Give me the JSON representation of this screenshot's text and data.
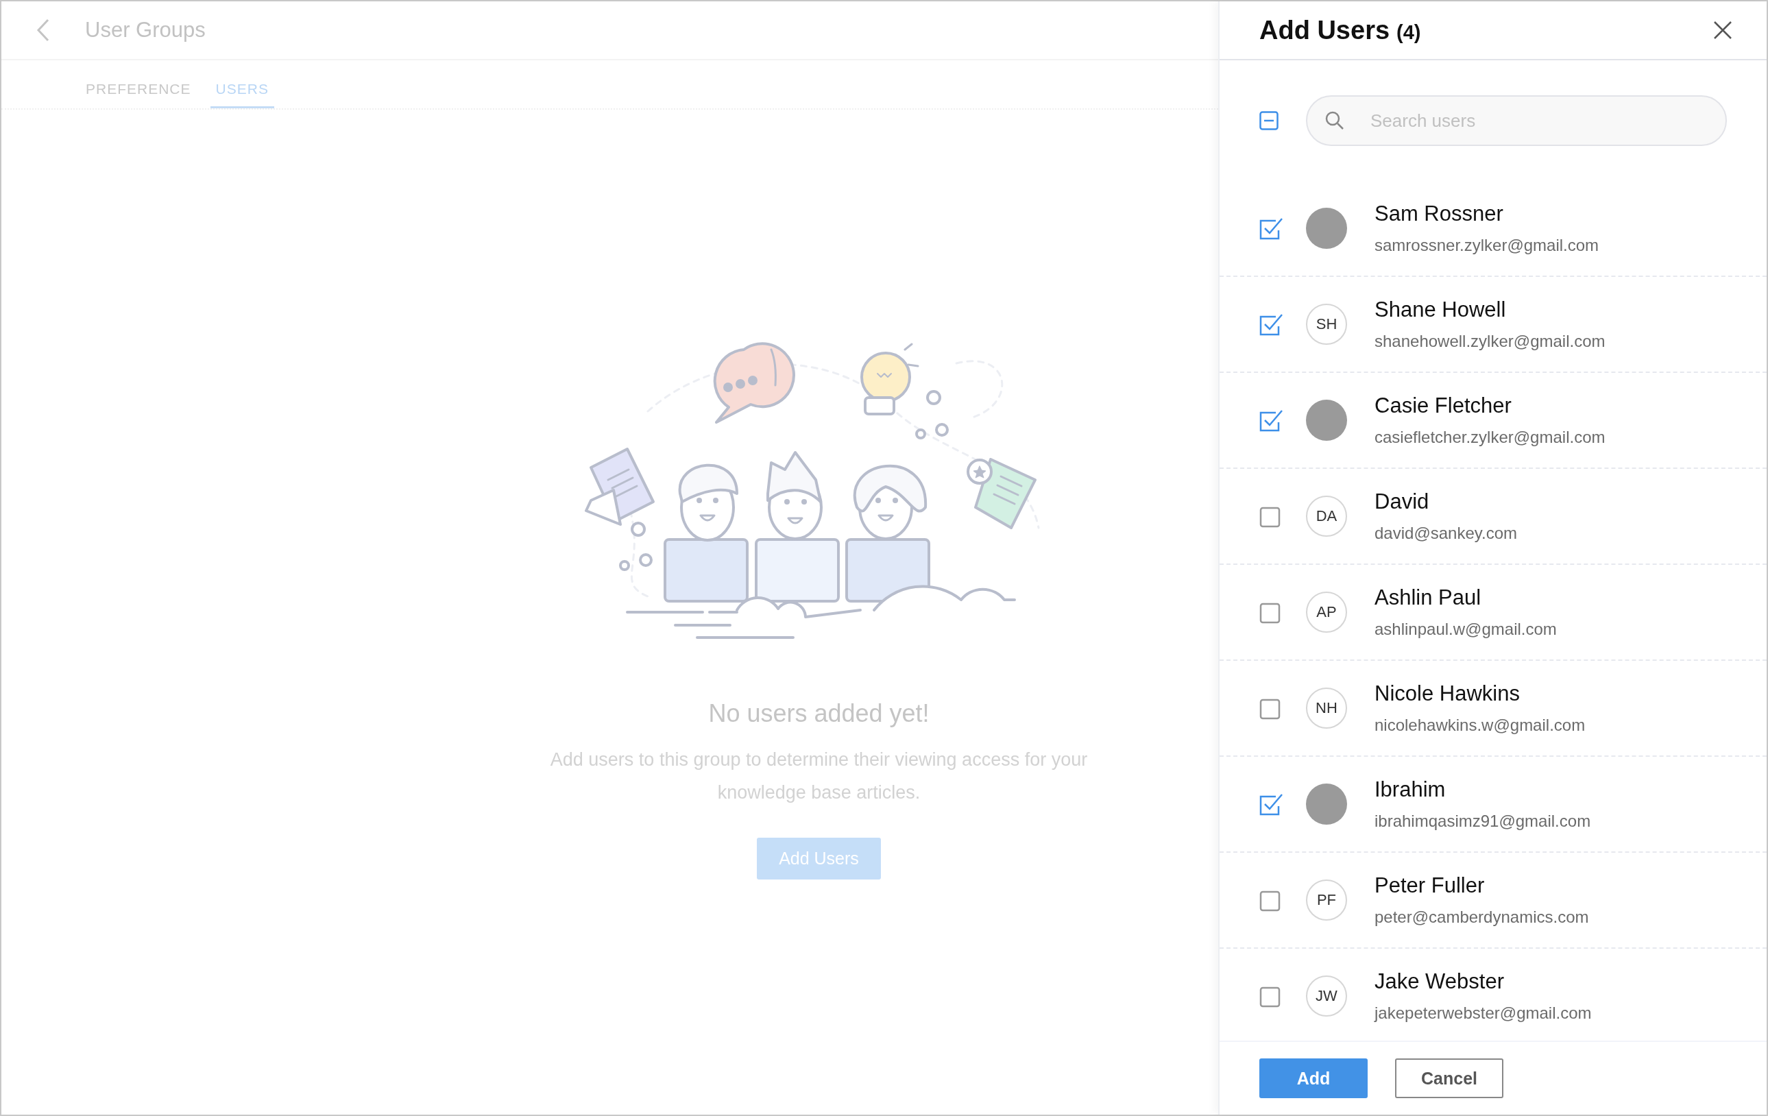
{
  "page": {
    "title": "User Groups",
    "tabs": [
      {
        "label": "PREFERENCE",
        "selected": false
      },
      {
        "label": "USERS",
        "selected": true
      }
    ],
    "empty_state": {
      "heading": "No users added yet!",
      "message": "Add users to this group to determine their viewing access for your knowledge base articles.",
      "button": "Add Users"
    }
  },
  "panel": {
    "title": "Add Users",
    "count": "(4)",
    "select_all": {
      "indeterminate": true
    },
    "search": {
      "placeholder": "Search users"
    },
    "users": [
      {
        "name": "Sam Rossner",
        "email": "samrossner.zylker@gmail.com",
        "checked": true,
        "kind": "photo"
      },
      {
        "name": "Shane Howell",
        "email": "shanehowell.zylker@gmail.com",
        "checked": true,
        "kind": "initials",
        "initials": "SH"
      },
      {
        "name": "Casie Fletcher",
        "email": "casiefletcher.zylker@gmail.com",
        "checked": true,
        "kind": "photo"
      },
      {
        "name": "David",
        "email": "david@sankey.com",
        "checked": false,
        "kind": "initials",
        "initials": "DA"
      },
      {
        "name": "Ashlin Paul",
        "email": "ashlinpaul.w@gmail.com",
        "checked": false,
        "kind": "initials",
        "initials": "AP"
      },
      {
        "name": "Nicole Hawkins",
        "email": "nicolehawkins.w@gmail.com",
        "checked": false,
        "kind": "initials",
        "initials": "NH"
      },
      {
        "name": "Ibrahim",
        "email": "ibrahimqasimz91@gmail.com",
        "checked": true,
        "kind": "photo"
      },
      {
        "name": "Peter Fuller",
        "email": "peter@camberdynamics.com",
        "checked": false,
        "kind": "initials",
        "initials": "PF"
      },
      {
        "name": "Jake Webster",
        "email": "jakepeterwebster@gmail.com",
        "checked": false,
        "kind": "initials",
        "initials": "JW"
      }
    ],
    "buttons": [
      {
        "label": "Add",
        "kind": "primary"
      },
      {
        "label": "Cancel",
        "kind": "secondary"
      }
    ]
  }
}
